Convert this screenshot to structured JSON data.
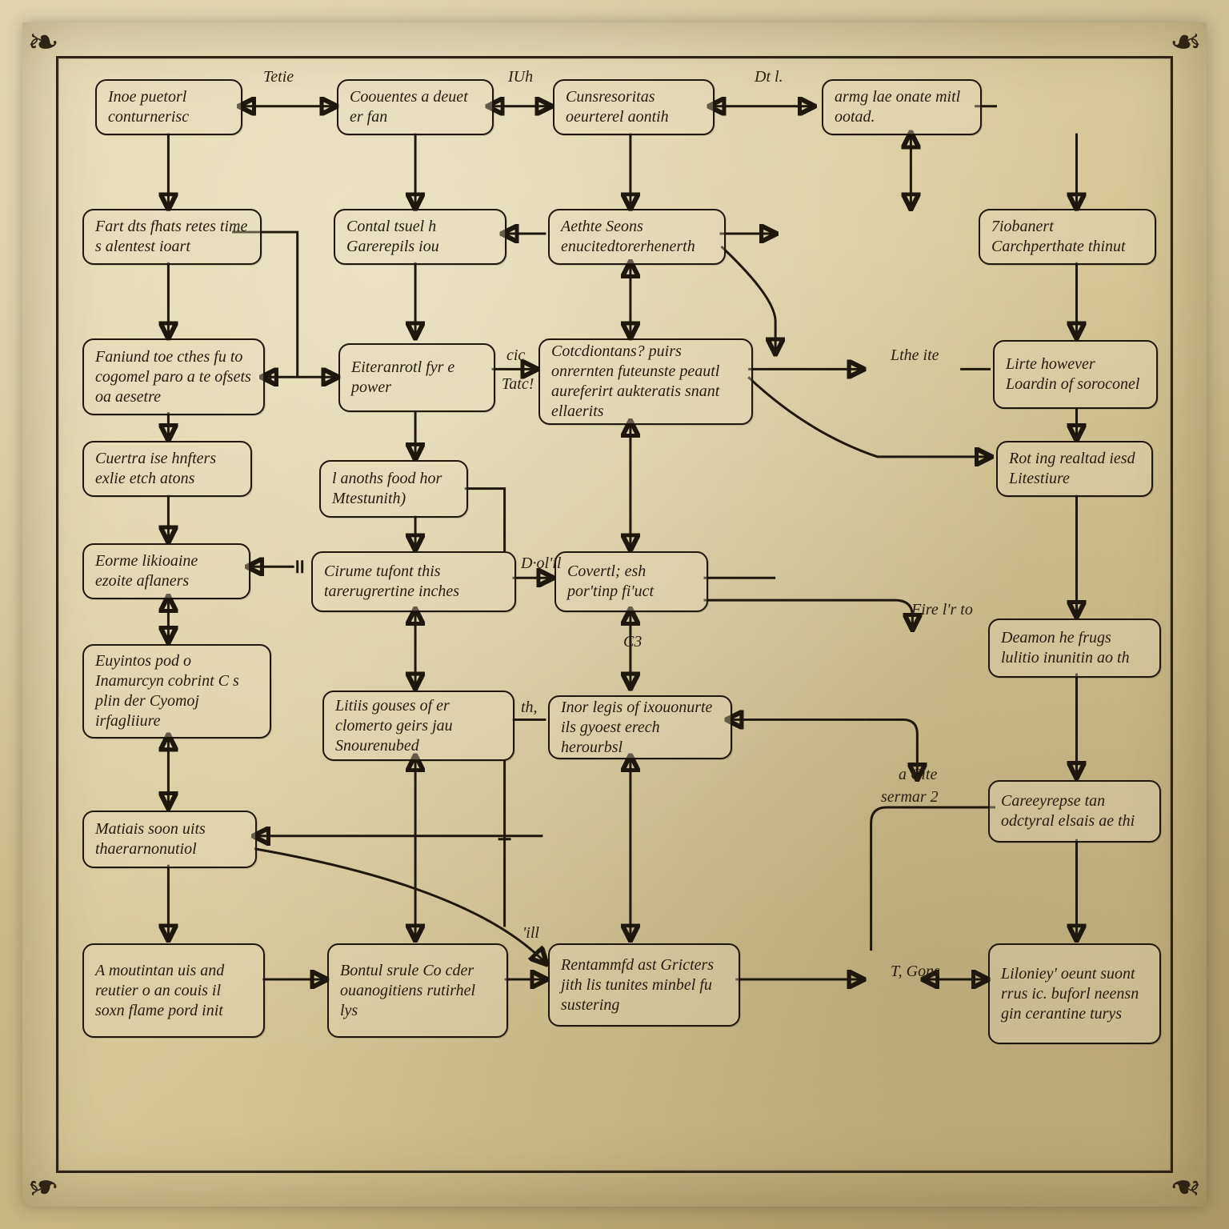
{
  "nodes": {
    "n_a1": "Inoe puetorl conturnerisc",
    "n_a2": "Coouentes a deuet er fan",
    "n_a3": "Cunsresoritas oeurterel aontih",
    "n_a4": "armg lae onate mitl ootad.",
    "n_b1": "Fart dts fhats retes time s alentest ioart",
    "n_b2": "Contal tsuel h Garerepils iou",
    "n_b3": "Aethte Seons enucitedtorerhenerth",
    "n_b4": "7iobanert Carchperthate thinut",
    "n_c1": "Faniund toe cthes fu to cogomel paro a te ofsets oa aesetre",
    "n_c2": "Eiteranrotl fyr e power",
    "n_c3": "Cotcdiontans? puirs onrernten futeunste peautl aureferirt aukteratis snant ellaerits",
    "n_c4": "Lirte however Loardin of soroconel",
    "n_d1": "Cuertra ise hnfters exlie etch atons",
    "n_d2": "l anoths food hor Mtestunith)",
    "n_d4": "Rot ing realtad iesd Litestiure",
    "n_e1": "Eorme likioaine ezoite aflaners",
    "n_e2": "Cirume tufont this tarerugrertine inches",
    "n_e3": "Covertl; esh por'tinp fi'uct",
    "n_e5": "Deamon he frugs lulitio inunitin ao th",
    "n_f1": "Euyintos pod o Inamurcyn cobrint C s plin der Cyomoj irfagliiure",
    "n_f2": "Litiis gouses of er clomerto geirs jau Snourenubed",
    "n_f3": "Inor legis of ixouonurte ils gyoest erech herourbsl",
    "n_f5": "Careeyrepse tan odctyral elsais ae thi",
    "n_g1": "Matiais soon uits thaerarnonutiol",
    "n_h1": "A moutintan uis and reutier o an couis il soxn flame pord init",
    "n_h2": "Bontul srule Co cder ouanogitiens rutirhel lys",
    "n_h3": "Rentammfd ast Gricters jith lis tunites minbel fu sustering",
    "n_h4": "Liloniey' oeunt suont rrus ic. buforl neensn gin cerantine turys"
  },
  "labels": {
    "l_a12": "Tetie",
    "l_a23": "IUh",
    "l_a34": "Dt l.",
    "l_c23a": "cic",
    "l_c23b": "Tatc!",
    "l_c34": "Lthe  ite",
    "l_e23": "D·ol'il",
    "l_e35": "C3",
    "l_e45": "Fire  l'r  to",
    "l_f23": "th,",
    "l_f45a": "a Cite",
    "l_f45b": "sermar 2",
    "l_h23": "'ill",
    "l_h34": "T, Gons"
  },
  "colors": {
    "ink": "#1e170b"
  }
}
